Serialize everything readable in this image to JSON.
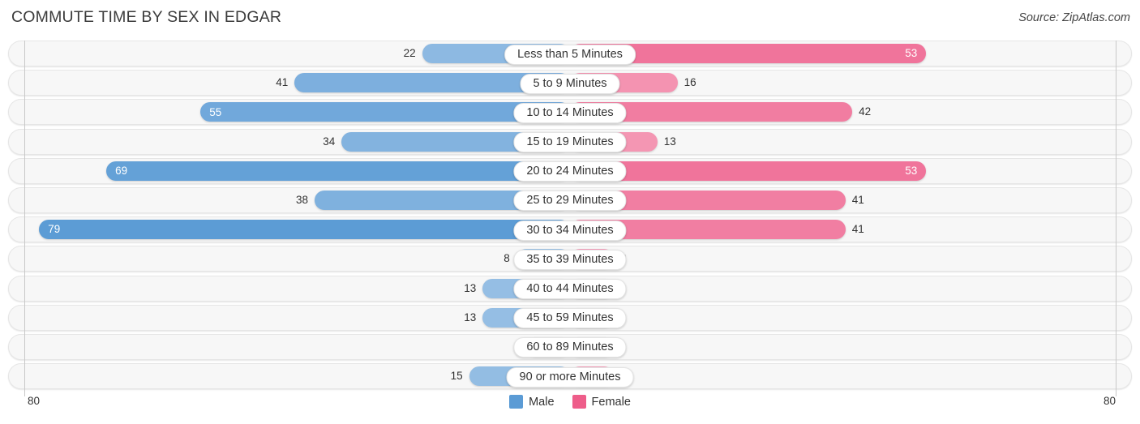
{
  "header": {
    "title": "COMMUTE TIME BY SEX IN EDGAR",
    "source": "Source: ZipAtlas.com"
  },
  "axis": {
    "left_max": "80",
    "right_max": "80"
  },
  "legend": {
    "items": [
      {
        "label": "Male",
        "color": "#5b9bd5"
      },
      {
        "label": "Female",
        "color": "#ee5d8a"
      }
    ]
  },
  "chart_data": {
    "type": "bar",
    "orientation": "horizontal-diverging",
    "title": "COMMUTE TIME BY SEX IN EDGAR",
    "xlabel": "",
    "ylabel": "",
    "xlim": [
      -80,
      80
    ],
    "axis_max": 80,
    "grid": false,
    "legend_position": "bottom-center",
    "categories": [
      "Less than 5 Minutes",
      "5 to 9 Minutes",
      "10 to 14 Minutes",
      "15 to 19 Minutes",
      "20 to 24 Minutes",
      "25 to 29 Minutes",
      "30 to 34 Minutes",
      "35 to 39 Minutes",
      "40 to 44 Minutes",
      "45 to 59 Minutes",
      "60 to 89 Minutes",
      "90 or more Minutes"
    ],
    "series": [
      {
        "name": "Male",
        "color": "#5b9bd5",
        "values": [
          22,
          41,
          55,
          34,
          69,
          38,
          79,
          8,
          13,
          13,
          0,
          15
        ]
      },
      {
        "name": "Female",
        "color": "#ee5d8a",
        "values": [
          53,
          16,
          42,
          13,
          53,
          41,
          41,
          2,
          3,
          3,
          3,
          3
        ]
      }
    ]
  }
}
